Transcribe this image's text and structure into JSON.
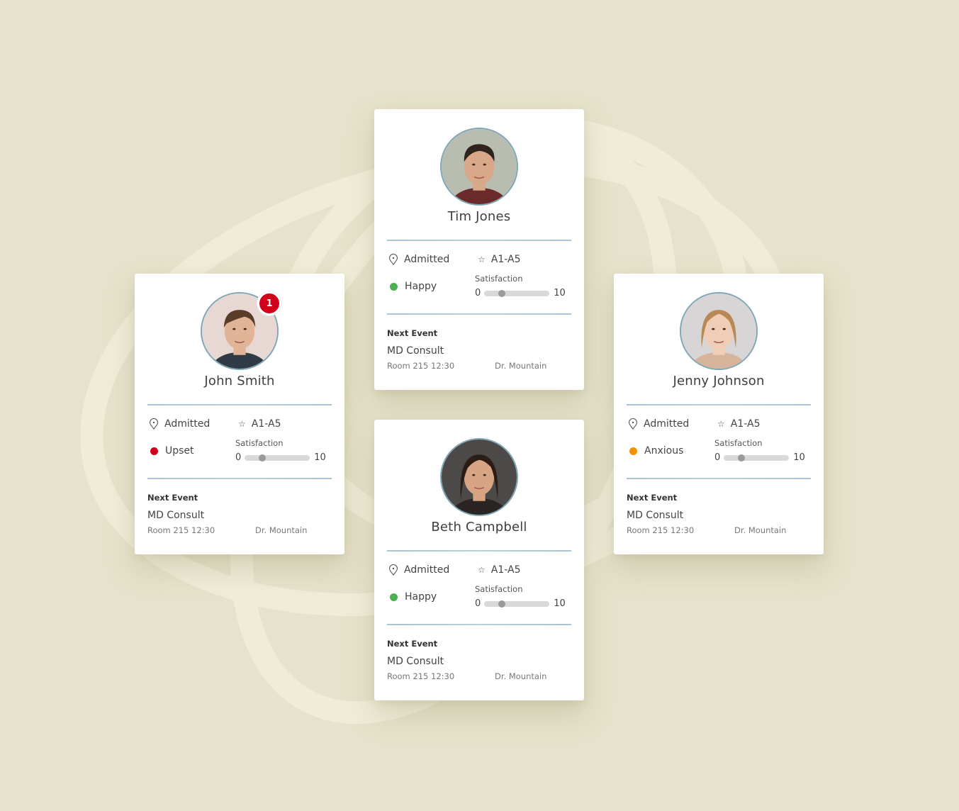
{
  "colors": {
    "background": "#e6e2cb",
    "ring": "#efecd8",
    "badge": "#d0021b",
    "mood_upset": "#d0021b",
    "mood_happy": "#4caf50",
    "mood_anxious": "#f39200",
    "divider": "#a7c3cd"
  },
  "cards": [
    {
      "name": "John Smith",
      "avatar_icon": "patient-photo",
      "notification_count": "1",
      "status": "Admitted",
      "status_icon": "location-pin-icon",
      "room": "A1-A5",
      "room_icon": "star-icon",
      "mood": "Upset",
      "mood_color": "#d0021b",
      "satisfaction_label": "Satisfaction",
      "satisfaction_min": "0",
      "satisfaction_max": "10",
      "satisfaction_value": 2,
      "next_event_label": "Next Event",
      "event_title": "MD Consult",
      "event_room_time": "Room 215 12:30",
      "event_doctor": "Dr. Mountain"
    },
    {
      "name": "Tim Jones",
      "avatar_icon": "patient-photo",
      "status": "Admitted",
      "status_icon": "location-pin-icon",
      "room": "A1-A5",
      "room_icon": "star-icon",
      "mood": "Happy",
      "mood_color": "#4caf50",
      "satisfaction_label": "Satisfaction",
      "satisfaction_min": "0",
      "satisfaction_max": "10",
      "satisfaction_value": 2,
      "next_event_label": "Next Event",
      "event_title": "MD Consult",
      "event_room_time": "Room 215 12:30",
      "event_doctor": "Dr. Mountain"
    },
    {
      "name": "Jenny Johnson",
      "avatar_icon": "patient-photo",
      "status": "Admitted",
      "status_icon": "location-pin-icon",
      "room": "A1-A5",
      "room_icon": "star-icon",
      "mood": "Anxious",
      "mood_color": "#f39200",
      "satisfaction_label": "Satisfaction",
      "satisfaction_min": "0",
      "satisfaction_max": "10",
      "satisfaction_value": 2,
      "next_event_label": "Next Event",
      "event_title": "MD Consult",
      "event_room_time": "Room 215 12:30",
      "event_doctor": "Dr. Mountain"
    },
    {
      "name": "Beth Campbell",
      "avatar_icon": "patient-photo",
      "status": "Admitted",
      "status_icon": "location-pin-icon",
      "room": "A1-A5",
      "room_icon": "star-icon",
      "mood": "Happy",
      "mood_color": "#4caf50",
      "satisfaction_label": "Satisfaction",
      "satisfaction_min": "0",
      "satisfaction_max": "10",
      "satisfaction_value": 2,
      "next_event_label": "Next Event",
      "event_title": "MD Consult",
      "event_room_time": "Room 215 12:30",
      "event_doctor": "Dr. Mountain"
    }
  ]
}
